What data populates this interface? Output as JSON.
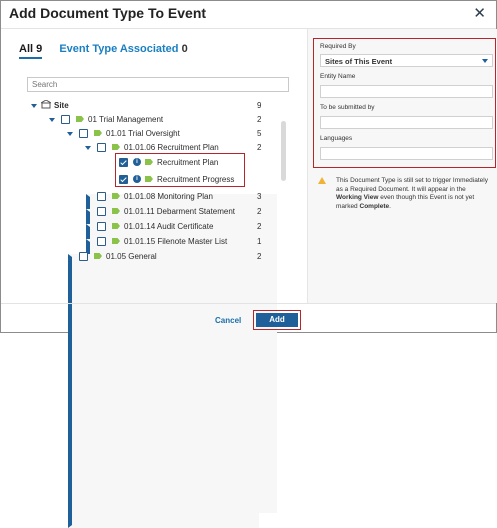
{
  "dialog": {
    "title": "Add Document Type To Event",
    "close_glyph": "✕"
  },
  "tabs": {
    "all_label": "All",
    "all_count": "9",
    "assoc_label": "Event Type Associated",
    "assoc_count": "0"
  },
  "search": {
    "placeholder": "Search"
  },
  "tree": {
    "site": {
      "label": "Site",
      "count": "9"
    },
    "trial_mgmt": {
      "label": "01 Trial Management",
      "count": "2"
    },
    "trial_oversight": {
      "label": "01.01 Trial Oversight",
      "count": "5"
    },
    "recruitment_plan_group": {
      "label": "01.01.06 Recruitment Plan",
      "count": "2"
    },
    "recruitment_plan": {
      "label": "Recruitment Plan",
      "checked": true
    },
    "recruitment_progress": {
      "label": "Recruitment Progress",
      "checked": true
    },
    "monitoring_plan": {
      "label": "01.01.08 Monitoring Plan",
      "count": "3"
    },
    "debarment": {
      "label": "01.01.11 Debarment Statement",
      "count": "2"
    },
    "audit_cert": {
      "label": "01.01.14 Audit Certificate",
      "count": "2"
    },
    "filenote": {
      "label": "01.01.15 Filenote Master List",
      "count": "1"
    },
    "general": {
      "label": "01.05 General",
      "count": "2"
    }
  },
  "right_panel": {
    "required_by_label": "Required By",
    "required_by_value": "Sites of This Event",
    "entity_name_label": "Entity Name",
    "entity_name_value": "",
    "submitted_by_label": "To be submitted by",
    "submitted_by_value": "",
    "languages_label": "Languages",
    "languages_value": "",
    "note_1": "This Document Type is still set to trigger Immediately as a Required Document. It will appear in the",
    "note_working_view": "Working View",
    "note_2": "even though this Event is not yet marked",
    "note_complete": "Complete",
    "note_end": "."
  },
  "footer": {
    "cancel_label": "Cancel",
    "add_label": "Add"
  },
  "colors": {
    "accent": "#1f5f9a",
    "highlight": "#b3262b",
    "tag": "#8bc34a",
    "warning": "#f2b233"
  }
}
